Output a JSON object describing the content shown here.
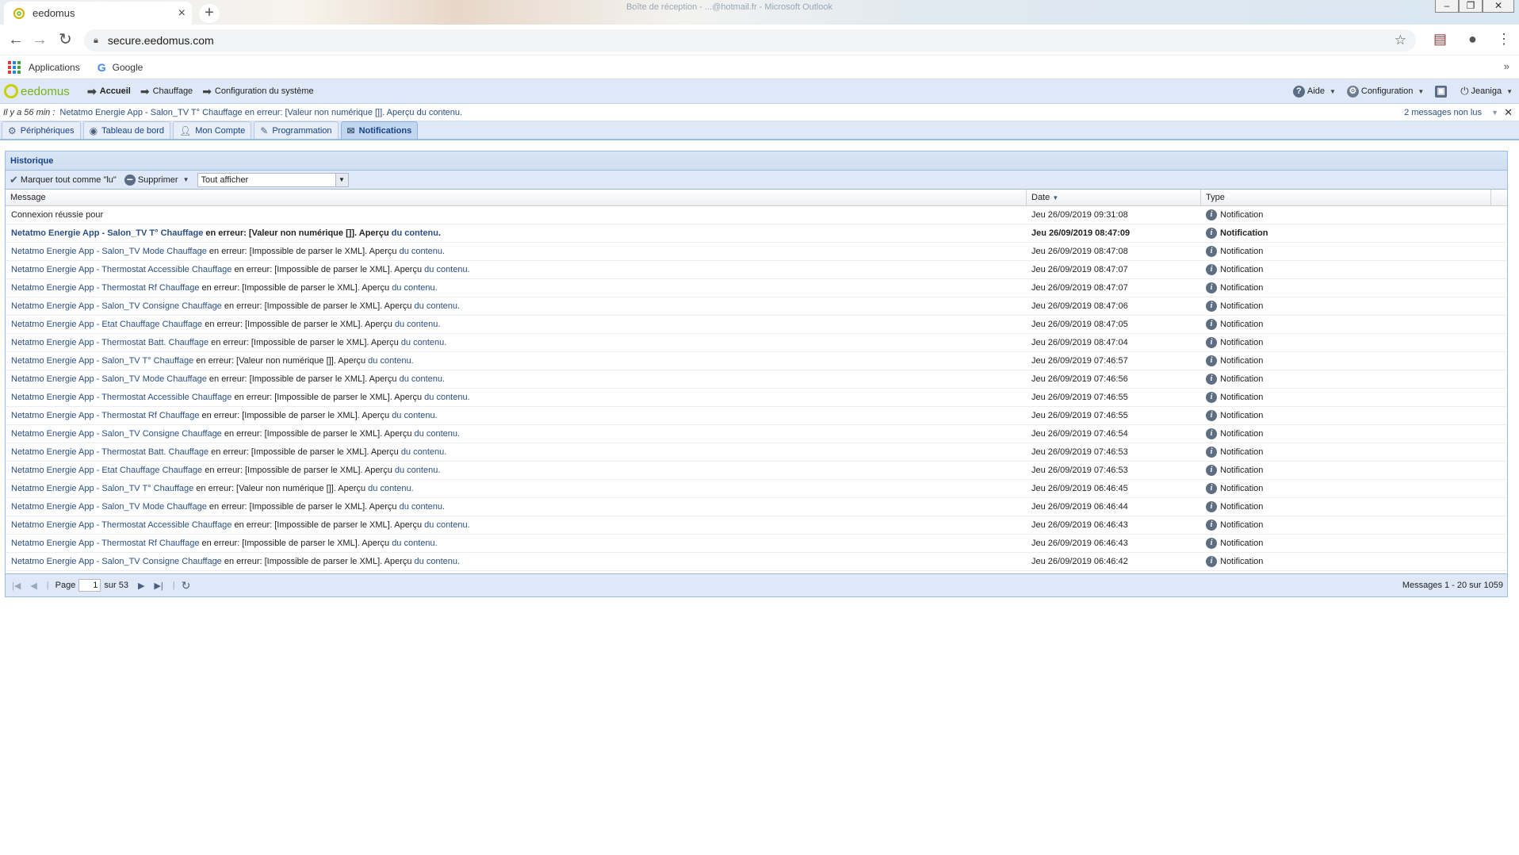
{
  "browser": {
    "tab_title": "eedomus",
    "window_title": "Boîte de réception - ...@hotmail.fr - Microsoft Outlook",
    "url": "secure.eedomus.com",
    "bookmarks": [
      "Applications",
      "Google"
    ]
  },
  "app": {
    "logo_text": "eedomus",
    "breadcrumbs": [
      "Accueil",
      "Chauffage",
      "Configuration du système"
    ],
    "menu": {
      "help": "Aide",
      "config": "Configuration",
      "user": "Jeaniga"
    }
  },
  "notification_bar": {
    "time": "Il y a 56 min :",
    "text": "Netatmo Energie App - Salon_TV T° Chauffage en erreur: [Valeur non numérique []]. Aperçu du contenu.",
    "unread": "2 messages non lus"
  },
  "nav_tabs": [
    {
      "label": "Périphériques",
      "icon": "gear-icon"
    },
    {
      "label": "Tableau de bord",
      "icon": "dashboard-icon"
    },
    {
      "label": "Mon Compte",
      "icon": "user-icon"
    },
    {
      "label": "Programmation",
      "icon": "wrench-icon"
    },
    {
      "label": "Notifications",
      "icon": "envelope-icon",
      "active": true
    }
  ],
  "panel": {
    "title": "Historique",
    "mark_read": "Marquer tout comme \"lu\"",
    "delete": "Supprimer",
    "filter": "Tout afficher",
    "columns": [
      "Message",
      "Date",
      "Type"
    ]
  },
  "rows": [
    {
      "prefix": "",
      "link": "",
      "mid": "Connexion réussie pour",
      "suffix": "",
      "date": "Jeu 26/09/2019 09:31:08",
      "type": "Notification"
    },
    {
      "prefix": "",
      "link": "Netatmo Energie App - Salon_TV T° Chauffage",
      "mid": " en erreur: [Valeur non numérique []]. Aperçu ",
      "suffix": "du contenu",
      "date": "Jeu 26/09/2019 08:47:09",
      "type": "Notification",
      "bold": true
    },
    {
      "prefix": "",
      "link": "Netatmo Energie App - Salon_TV Mode Chauffage",
      "mid": " en erreur: [Impossible de parser le XML]. Aperçu ",
      "suffix": "du contenu.",
      "date": "Jeu 26/09/2019 08:47:08",
      "type": "Notification"
    },
    {
      "prefix": "",
      "link": "Netatmo Energie App - Thermostat Accessible Chauffage",
      "mid": " en erreur: [Impossible de parser le XML]. Aperçu ",
      "suffix": "du contenu.",
      "date": "Jeu 26/09/2019 08:47:07",
      "type": "Notification"
    },
    {
      "prefix": "",
      "link": "Netatmo Energie App - Thermostat Rf Chauffage",
      "mid": " en erreur: [Impossible de parser le XML]. Aperçu ",
      "suffix": "du contenu.",
      "date": "Jeu 26/09/2019 08:47:07",
      "type": "Notification"
    },
    {
      "prefix": "",
      "link": "Netatmo Energie App - Salon_TV Consigne Chauffage",
      "mid": " en erreur: [Impossible de parser le XML]. Aperçu ",
      "suffix": "du contenu.",
      "date": "Jeu 26/09/2019 08:47:06",
      "type": "Notification"
    },
    {
      "prefix": "",
      "link": "Netatmo Energie App - Etat Chauffage Chauffage",
      "mid": " en erreur: [Impossible de parser le XML]. Aperçu ",
      "suffix": "du contenu.",
      "date": "Jeu 26/09/2019 08:47:05",
      "type": "Notification"
    },
    {
      "prefix": "",
      "link": "Netatmo Energie App - Thermostat Batt. Chauffage",
      "mid": " en erreur: [Impossible de parser le XML]. Aperçu ",
      "suffix": "du contenu.",
      "date": "Jeu 26/09/2019 08:47:04",
      "type": "Notification"
    },
    {
      "prefix": "",
      "link": "Netatmo Energie App - Salon_TV T° Chauffage",
      "mid": " en erreur: [Valeur non numérique []]. Aperçu ",
      "suffix": "du contenu.",
      "date": "Jeu 26/09/2019 07:46:57",
      "type": "Notification"
    },
    {
      "prefix": "",
      "link": "Netatmo Energie App - Salon_TV Mode Chauffage",
      "mid": " en erreur: [Impossible de parser le XML]. Aperçu ",
      "suffix": "du contenu.",
      "date": "Jeu 26/09/2019 07:46:56",
      "type": "Notification"
    },
    {
      "prefix": "",
      "link": "Netatmo Energie App - Thermostat Accessible Chauffage",
      "mid": " en erreur: [Impossible de parser le XML]. Aperçu ",
      "suffix": "du contenu.",
      "date": "Jeu 26/09/2019 07:46:55",
      "type": "Notification"
    },
    {
      "prefix": "",
      "link": "Netatmo Energie App - Thermostat Rf Chauffage",
      "mid": " en erreur: [Impossible de parser le XML]. Aperçu ",
      "suffix": "du contenu.",
      "date": "Jeu 26/09/2019 07:46:55",
      "type": "Notification"
    },
    {
      "prefix": "",
      "link": "Netatmo Energie App - Salon_TV Consigne Chauffage",
      "mid": " en erreur: [Impossible de parser le XML]. Aperçu ",
      "suffix": "du contenu.",
      "date": "Jeu 26/09/2019 07:46:54",
      "type": "Notification"
    },
    {
      "prefix": "",
      "link": "Netatmo Energie App - Thermostat Batt. Chauffage",
      "mid": " en erreur: [Impossible de parser le XML]. Aperçu ",
      "suffix": "du contenu.",
      "date": "Jeu 26/09/2019 07:46:53",
      "type": "Notification"
    },
    {
      "prefix": "",
      "link": "Netatmo Energie App - Etat Chauffage Chauffage",
      "mid": " en erreur: [Impossible de parser le XML]. Aperçu ",
      "suffix": "du contenu.",
      "date": "Jeu 26/09/2019 07:46:53",
      "type": "Notification"
    },
    {
      "prefix": "",
      "link": "Netatmo Energie App - Salon_TV T° Chauffage",
      "mid": " en erreur: [Valeur non numérique []]. Aperçu ",
      "suffix": "du contenu.",
      "date": "Jeu 26/09/2019 06:46:45",
      "type": "Notification"
    },
    {
      "prefix": "",
      "link": "Netatmo Energie App - Salon_TV Mode Chauffage",
      "mid": " en erreur: [Impossible de parser le XML]. Aperçu ",
      "suffix": "du contenu.",
      "date": "Jeu 26/09/2019 06:46:44",
      "type": "Notification"
    },
    {
      "prefix": "",
      "link": "Netatmo Energie App - Thermostat Accessible Chauffage",
      "mid": " en erreur: [Impossible de parser le XML]. Aperçu ",
      "suffix": "du contenu.",
      "date": "Jeu 26/09/2019 06:46:43",
      "type": "Notification"
    },
    {
      "prefix": "",
      "link": "Netatmo Energie App - Thermostat Rf Chauffage",
      "mid": " en erreur: [Impossible de parser le XML]. Aperçu ",
      "suffix": "du contenu.",
      "date": "Jeu 26/09/2019 06:46:43",
      "type": "Notification"
    },
    {
      "prefix": "",
      "link": "Netatmo Energie App - Salon_TV Consigne Chauffage",
      "mid": " en erreur: [Impossible de parser le XML]. Aperçu ",
      "suffix": "du contenu.",
      "date": "Jeu 26/09/2019 06:46:42",
      "type": "Notification"
    }
  ],
  "pager": {
    "page_label": "Page",
    "page": "1",
    "of": "sur 53",
    "summary": "Messages 1 - 20 sur 1059"
  },
  "colors": {
    "accent": "#15428b",
    "link": "#2b4f85",
    "header_bg": "#dfe8f6",
    "border": "#99bbe8"
  }
}
